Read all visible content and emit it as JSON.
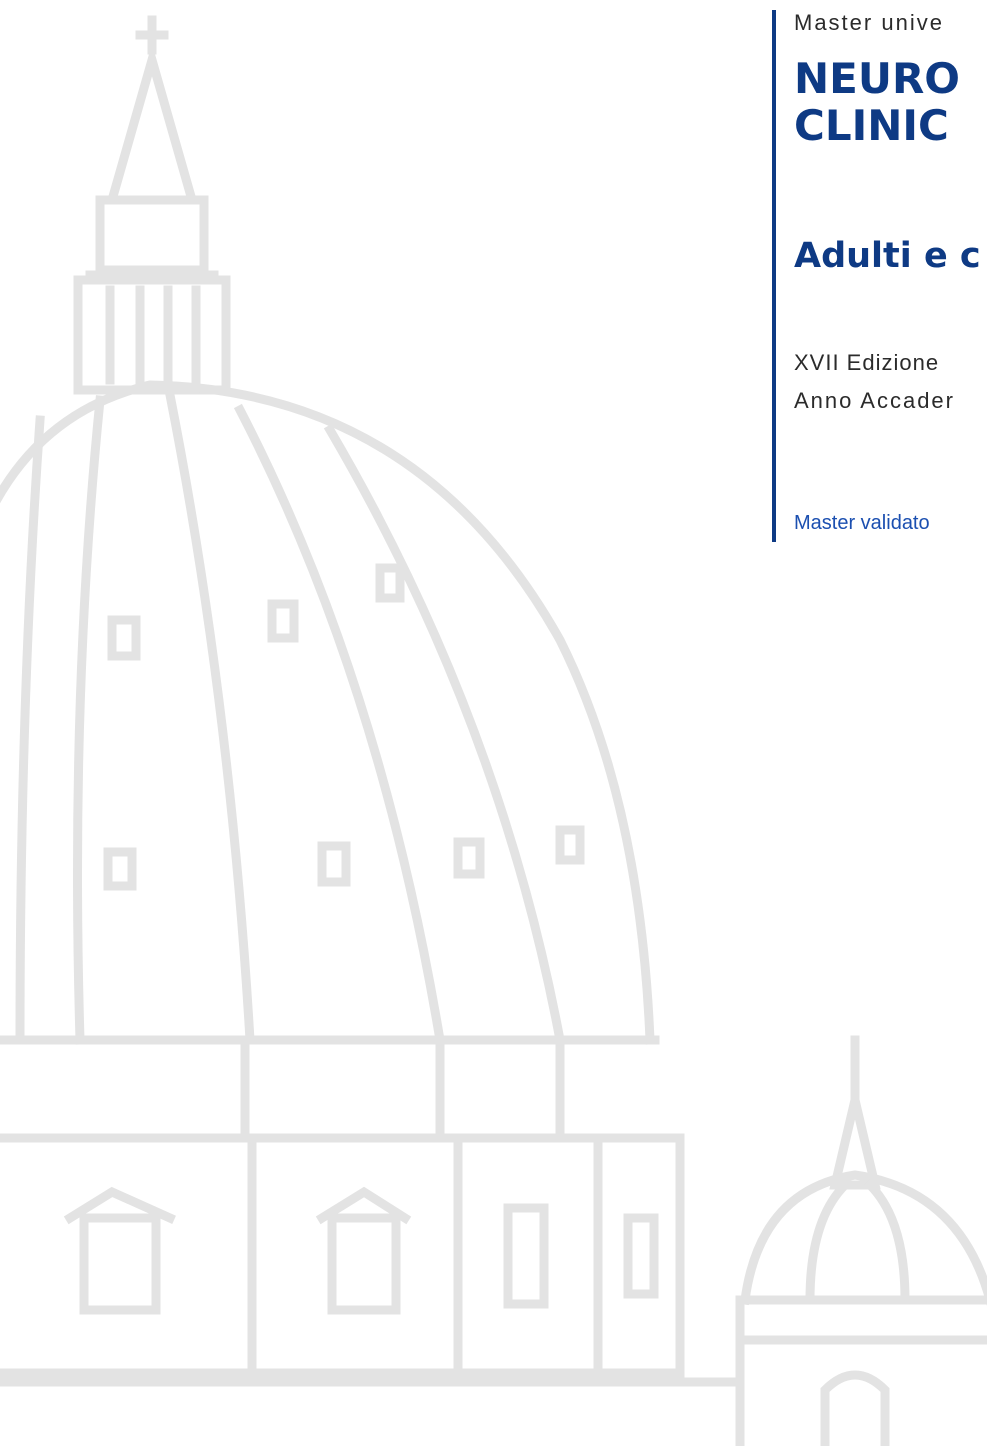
{
  "header": {
    "kicker": "Master unive",
    "title_line_1": "NEURO",
    "title_line_2": "CLINIC",
    "subtitle": "Adulti e c"
  },
  "details": {
    "edition": "XVII Edizione",
    "academic_year": "Anno Accader",
    "validation_note": "Master validato"
  },
  "illustration": {
    "subject": "dome-illustration",
    "stroke_color": "#e3e3e3"
  },
  "colors": {
    "brand_blue": "#0e3a84",
    "accent_blue": "#1b4fb0",
    "body_text": "#2b2b2b"
  }
}
